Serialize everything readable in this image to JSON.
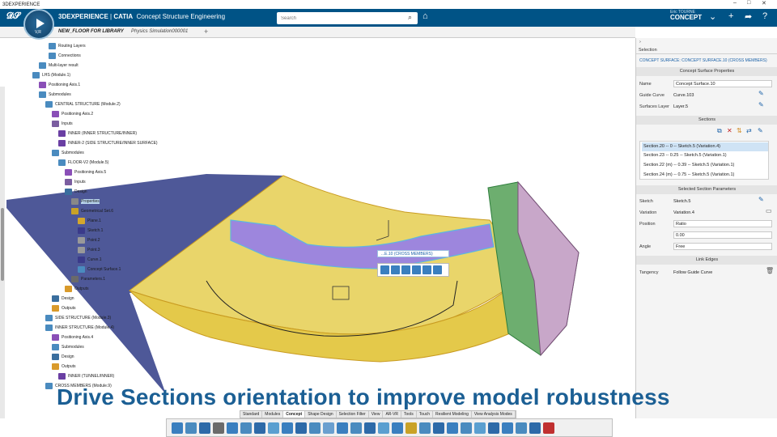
{
  "window": {
    "title": "3DEXPERIENCE",
    "controls": [
      "–",
      "□",
      "✕"
    ]
  },
  "topbar": {
    "brand": "3DEXPERIENCE",
    "app": "CATIA",
    "role": "Concept Structure Engineering",
    "compass_label": "V,R",
    "search_placeholder": "Search",
    "user_name": "Eric TOURNE",
    "user_context": "CONCEPT"
  },
  "tabs": [
    {
      "label": "NEW_FLOOR FOR LIBRARY"
    },
    {
      "label": "Physics Simulation000001"
    }
  ],
  "tree": [
    {
      "label": "Routing Layers",
      "icon": "#4a8bbf"
    },
    {
      "label": "Connections",
      "icon": "#4a8bbf"
    },
    {
      "label": "Multi-layer result",
      "icon": "#4a8bbf"
    },
    {
      "label": "LHS (Module.1)",
      "icon": "#4a8bbf"
    },
    {
      "label": "Positioning Axis.1",
      "icon": "#8a4fb7"
    },
    {
      "label": "Submodules",
      "icon": "#4a8bbf"
    },
    {
      "label": "CENTRAL STRUCTURE (Module.2)",
      "icon": "#4a8bbf"
    },
    {
      "label": "Positioning Axis.2",
      "icon": "#8a4fb7"
    },
    {
      "label": "Inputs",
      "icon": "#7b5ea0"
    },
    {
      "label": "INNER (INNER STRUCTURE/INNER)",
      "icon": "#6a3fa3"
    },
    {
      "label": "INNER-2 (SIDE STRUCTURE/INNER SURFACE)",
      "icon": "#6a3fa3"
    },
    {
      "label": "Submodules",
      "icon": "#4a8bbf"
    },
    {
      "label": "FLOOR-V2 (Module.5)",
      "icon": "#4a8bbf"
    },
    {
      "label": "Positioning Axis.5",
      "icon": "#8a4fb7"
    },
    {
      "label": "Inputs",
      "icon": "#7b5ea0"
    },
    {
      "label": "Design",
      "icon": "#3a6e9e"
    },
    {
      "label": "Properties",
      "icon": "#888888"
    },
    {
      "label": "Geometrical Set.6",
      "icon": "#c9a227"
    },
    {
      "label": "Plane.1",
      "icon": "#d4a72c"
    },
    {
      "label": "Sketch.1",
      "icon": "#3a3a8a"
    },
    {
      "label": "Point.2",
      "icon": "#999999"
    },
    {
      "label": "Point.3",
      "icon": "#999999"
    },
    {
      "label": "Curve.1",
      "icon": "#3a3a8a"
    },
    {
      "label": "Concept Surface.1",
      "icon": "#4a8bbf"
    },
    {
      "label": "Parameters.1",
      "icon": "#6a6a6a"
    },
    {
      "label": "Outputs",
      "icon": "#d99a2b"
    },
    {
      "label": "Design",
      "icon": "#3a6e9e"
    },
    {
      "label": "Outputs",
      "icon": "#d99a2b"
    },
    {
      "label": "SIDE STRUCTURE (Module.3)",
      "icon": "#4a8bbf"
    },
    {
      "label": "INNER STRUCTURE (Module.4)",
      "icon": "#4a8bbf"
    },
    {
      "label": "Positioning Axis.4",
      "icon": "#8a4fb7"
    },
    {
      "label": "Submodules",
      "icon": "#4a8bbf"
    },
    {
      "label": "Design",
      "icon": "#3a6e9e"
    },
    {
      "label": "Outputs",
      "icon": "#d99a2b"
    },
    {
      "label": "INNER (TUNNEL/INNER)",
      "icon": "#6a3fa3"
    },
    {
      "label": "CROSS MEMBERS (Module.9)",
      "icon": "#4a8bbf"
    }
  ],
  "viewport": {
    "context_label": "...E.10 (CROSS MEMBERS)",
    "colors": {
      "yellow": "#e9d56a",
      "navy": "#3f4a8f",
      "purple": "#9d86dd",
      "green": "#6dae6f",
      "lilac": "#c8a7c9"
    }
  },
  "panel": {
    "header": "Selection",
    "breadcrumb": "CONCEPT SURFACE: CONCEPT SURFACE.10 (CROSS MEMBERS)",
    "sec_props": "Concept Surface Properties",
    "name_label": "Name",
    "name_value": "Concept Surface.10",
    "guide_label": "Guide Curve",
    "guide_value": "Curve.103",
    "layer_label": "Surfaces Layer",
    "layer_value": "Layer.5",
    "sec_sections": "Sections",
    "sections": [
      "Section.20 -- 0 -- Sketch.5 (Variation.4)",
      "Section.23 -- 0.25 -- Sketch.5 (Variation.1)",
      "Section.22 (m) -- 0.39 -- Sketch.5 (Variation.1)",
      "Section.24 (m) -- 0.75 -- Sketch.5 (Variation.1)"
    ],
    "sec_selected": "Selected Section Parameters",
    "sketch_label": "Sketch",
    "sketch_value": "Sketch.5",
    "variation_label": "Variation",
    "variation_value": "Variation.4",
    "position_label": "Position",
    "position_value": "Ratio",
    "ratio_value": "0.00",
    "angle_label": "Angle",
    "angle_value": "Free",
    "sec_link": "Link Edges",
    "tangency_label": "Tangency",
    "tangency_value": "Follow Guide Curve"
  },
  "caption": "Drive Sections orientation to improve model robustness",
  "toolbar_tabs": [
    "Standard",
    "Modules",
    "Concept",
    "Shape Design",
    "Selection Filter",
    "View",
    "AR-VR",
    "Tools",
    "Touch",
    "Resilient Modeling",
    "View Analysis Modes"
  ],
  "toolbar_tools": [
    "#3a7fbf",
    "#4a8bbf",
    "#2d6aa8",
    "#6a6a6a",
    "#3a7fbf",
    "#4a8bbf",
    "#2d6aa8",
    "#5a9fd0",
    "#3a7fbf",
    "#2d6aa8",
    "#4a8bbf",
    "#6a9fcf",
    "#3a7fbf",
    "#4a8bbf",
    "#2d6aa8",
    "#5a9fd0",
    "#3a7fbf",
    "#c9a227",
    "#4a8bbf",
    "#2d6aa8",
    "#3a7fbf",
    "#4a8bbf",
    "#5a9fd0",
    "#2d6aa8",
    "#3a7fbf",
    "#4a8bbf",
    "#2d6aa8",
    "#c03030"
  ]
}
